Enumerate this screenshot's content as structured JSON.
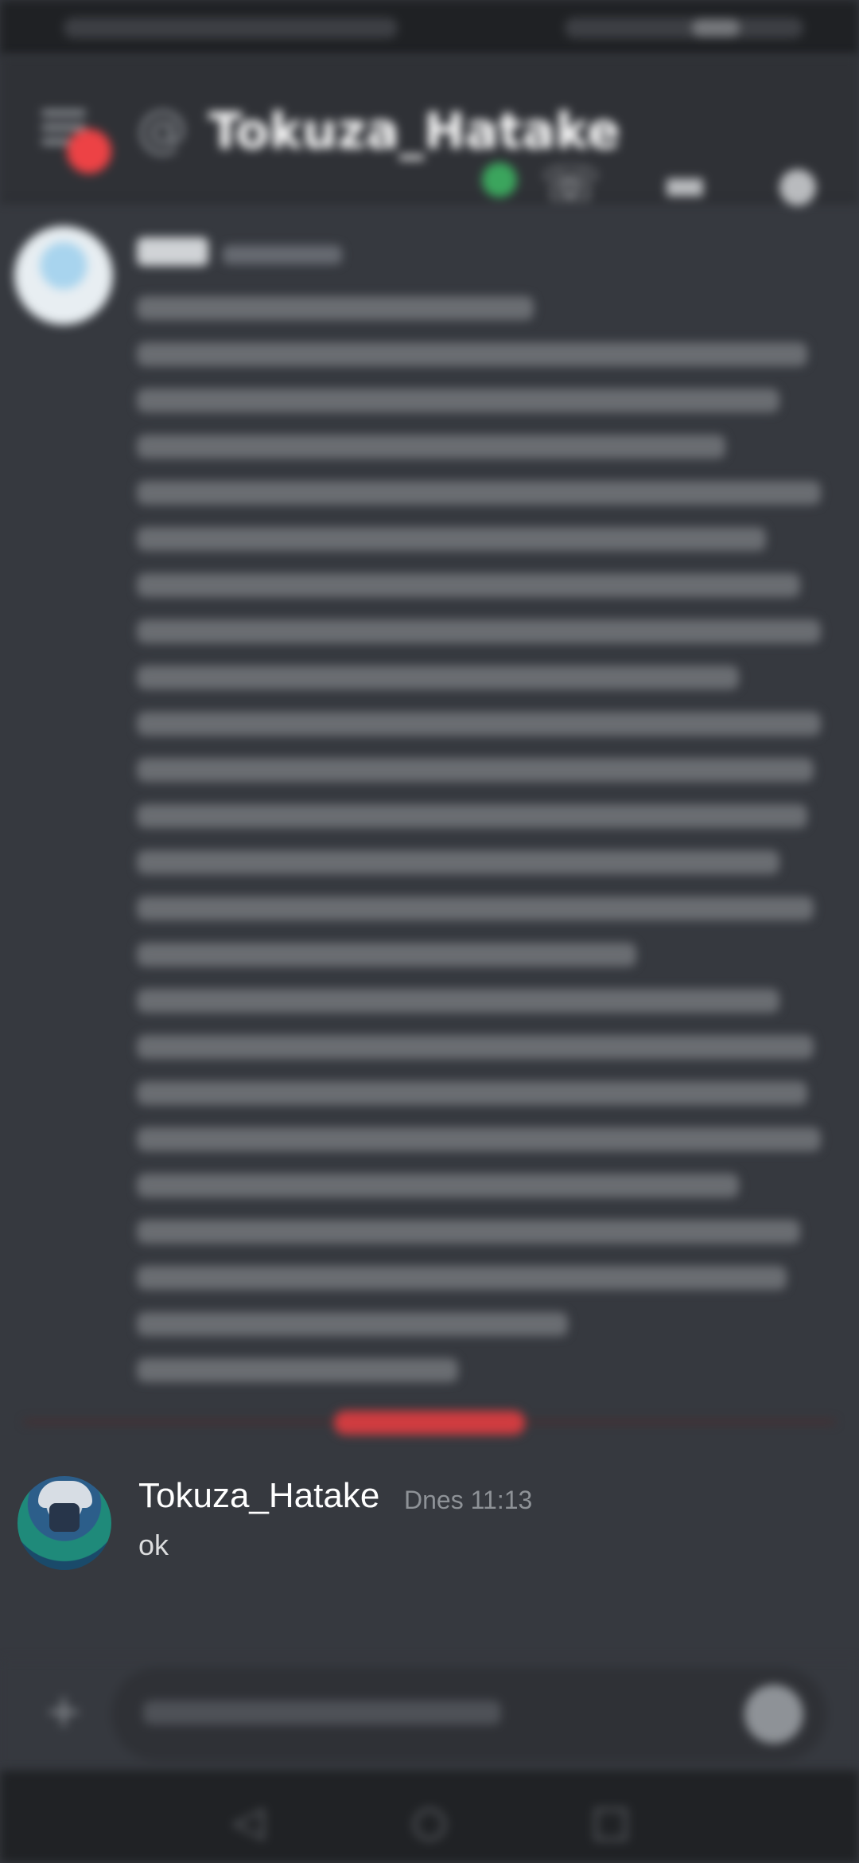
{
  "header": {
    "title": "Tokuza_Hatake",
    "icons": [
      "menu-icon",
      "at-icon",
      "phone-icon",
      "video-icon",
      "members-icon"
    ]
  },
  "messages": [
    {
      "author": "Tokuza_Hatake",
      "timestamp": "Dnes 11:13",
      "text": "ok"
    }
  ],
  "colors": {
    "background": "#36393f",
    "header": "#2f3136",
    "online": "#3ba55d",
    "new_marker": "#d03c40",
    "username": "#ffffff",
    "timestamp": "#8e9297"
  }
}
